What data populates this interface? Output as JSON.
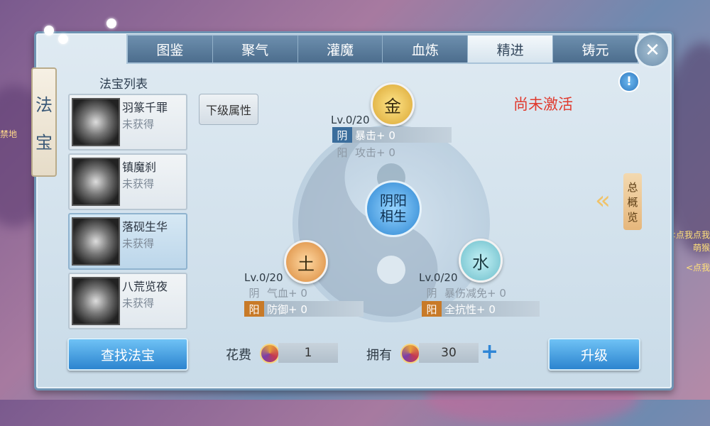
{
  "tabs": [
    "图鉴",
    "聚气",
    "灌魔",
    "血炼",
    "精进",
    "铸元"
  ],
  "active_tab": 4,
  "close_label": "✕",
  "side_label": [
    "法",
    "宝"
  ],
  "list_title": "法宝列表",
  "items": [
    {
      "name": "羽篆千罪",
      "status": "未获得"
    },
    {
      "name": "镇魔刹",
      "status": "未获得"
    },
    {
      "name": "落砚生华",
      "status": "未获得"
    },
    {
      "name": "八荒览夜",
      "status": "未获得"
    }
  ],
  "sub_attr_button": "下级属性",
  "info_icon": "!",
  "not_activated": "尚未激活",
  "center": [
    "阴阳",
    "相生"
  ],
  "gold": {
    "glyph": "金",
    "level": "Lv.0/20",
    "yin_tag": "阴",
    "yin_attr": "暴击+ 0",
    "yang_tag": "阳",
    "yang_attr": "攻击+ 0"
  },
  "earth": {
    "glyph": "土",
    "level": "Lv.0/20",
    "yin_tag": "阴",
    "yin_attr": "气血+ 0",
    "yang_tag": "阳",
    "yang_attr": "防御+ 0"
  },
  "water": {
    "glyph": "水",
    "level": "Lv.0/20",
    "yin_tag": "阴",
    "yin_attr": "暴伤减免+ 0",
    "yang_tag": "阳",
    "yang_attr": "全抗性+ 0"
  },
  "find_button": "查找法宝",
  "cost_label": "花费",
  "cost_value": "1",
  "own_label": "拥有",
  "own_value": "30",
  "plus": "+",
  "upgrade_button": "升级",
  "overview": [
    "总",
    "概",
    "览"
  ],
  "side_left_text": "禁地",
  "side_right_lines": [
    "<点我点我",
    "萌猴",
    "<点我"
  ]
}
